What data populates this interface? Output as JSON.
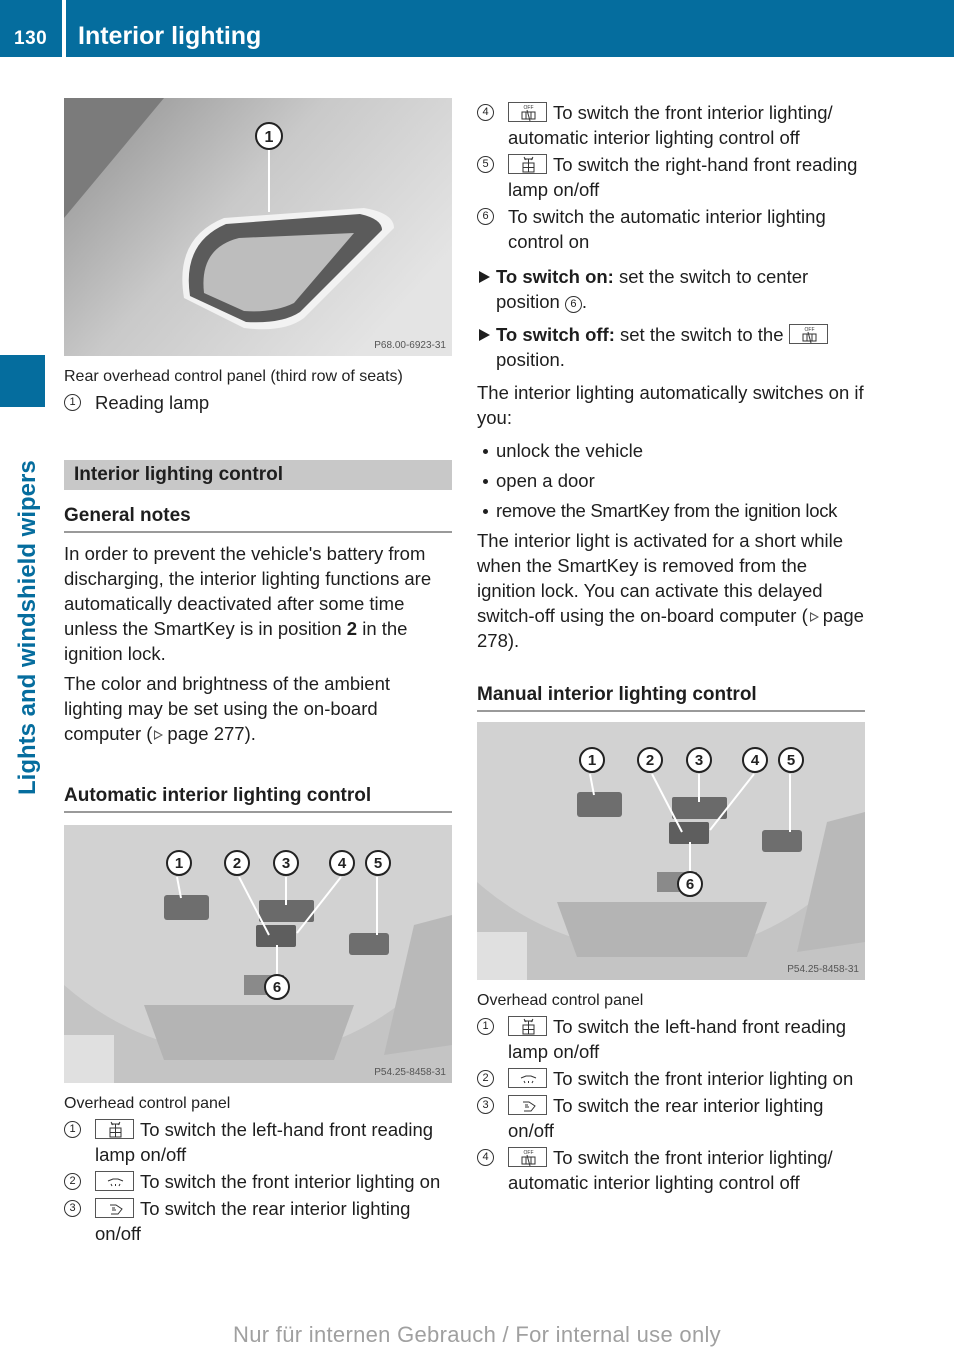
{
  "header": {
    "page_number": "130",
    "title": "Interior lighting",
    "color": "#056d9e"
  },
  "side_tab": {
    "label": "Lights and windshield wipers"
  },
  "left": {
    "photo1": {
      "code": "P68.00-6923-31",
      "callouts": [
        "1"
      ]
    },
    "photo1_caption": "Rear overhead control panel (third row of seats)",
    "photo1_legend": [
      {
        "num": "1",
        "text": "Reading lamp"
      }
    ],
    "section_title": "Interior lighting control",
    "general_notes": {
      "heading": "General notes",
      "para1_before": "In order to prevent the vehicle's battery from discharging, the interior lighting functions are automatically deactivated after some time unless the SmartKey is in position ",
      "para1_bold": "2",
      "para1_after": " in the ignition lock.",
      "para2_before": "The color and brightness of the ambient lighting may be set using the on-board computer (",
      "para2_ref": "page 277",
      "para2_after": ")."
    },
    "auto_heading": "Automatic interior lighting control",
    "photo2": {
      "code": "P54.25-8458-31",
      "callouts": [
        "1",
        "2",
        "3",
        "4",
        "5",
        "6"
      ]
    },
    "photo2_caption": "Overhead control panel",
    "photo2_legend": [
      {
        "num": "1",
        "icon": "reading-lamp-icon",
        "text": "To switch the left-hand front reading lamp on/off"
      },
      {
        "num": "2",
        "icon": "front-interior-light-icon",
        "text": "To switch the front interior lighting on"
      },
      {
        "num": "3",
        "icon": "rear-interior-light-icon",
        "text": "To switch the rear interior lighting on/off"
      }
    ]
  },
  "right": {
    "legend_cont": [
      {
        "num": "4",
        "icon": "interior-light-off-icon",
        "icon_label": "OFF",
        "text": "To switch the front interior lighting/ automatic interior lighting control off"
      },
      {
        "num": "5",
        "icon": "reading-lamp-icon",
        "text": "To switch the right-hand front reading lamp on/off"
      },
      {
        "num": "6",
        "text": "To switch the automatic interior lighting control on"
      }
    ],
    "switch_on": {
      "label": "To switch on:",
      "text": "set the switch to center position",
      "ref_num": "6",
      "end": "."
    },
    "switch_off": {
      "label": "To switch off:",
      "text": "set the switch to the",
      "end": "position."
    },
    "auto_para": "The interior lighting automatically switches on if you:",
    "auto_bullets": [
      "unlock the vehicle",
      "open a door",
      "remove the SmartKey from the ignition lock"
    ],
    "delay_para_before": "The interior light is activated for a short while when the SmartKey is removed from the ignition lock. You can activate this delayed switch-off using the on-board computer (",
    "delay_para_ref": "page 278",
    "delay_para_after": ").",
    "manual_heading": "Manual interior lighting control",
    "photo3": {
      "code": "P54.25-8458-31",
      "callouts": [
        "1",
        "2",
        "3",
        "4",
        "5",
        "6"
      ]
    },
    "photo3_caption": "Overhead control panel",
    "photo3_legend": [
      {
        "num": "1",
        "icon": "reading-lamp-icon",
        "text": "To switch the left-hand front reading lamp on/off"
      },
      {
        "num": "2",
        "icon": "front-interior-light-icon",
        "text": "To switch the front interior lighting on"
      },
      {
        "num": "3",
        "icon": "rear-interior-light-icon",
        "text": "To switch the rear interior lighting on/off"
      },
      {
        "num": "4",
        "icon": "interior-light-off-icon",
        "icon_label": "OFF",
        "text": "To switch the front interior lighting/ automatic interior lighting control off"
      }
    ]
  },
  "footer": {
    "text": "Nur für internen Gebrauch / For internal use only"
  }
}
